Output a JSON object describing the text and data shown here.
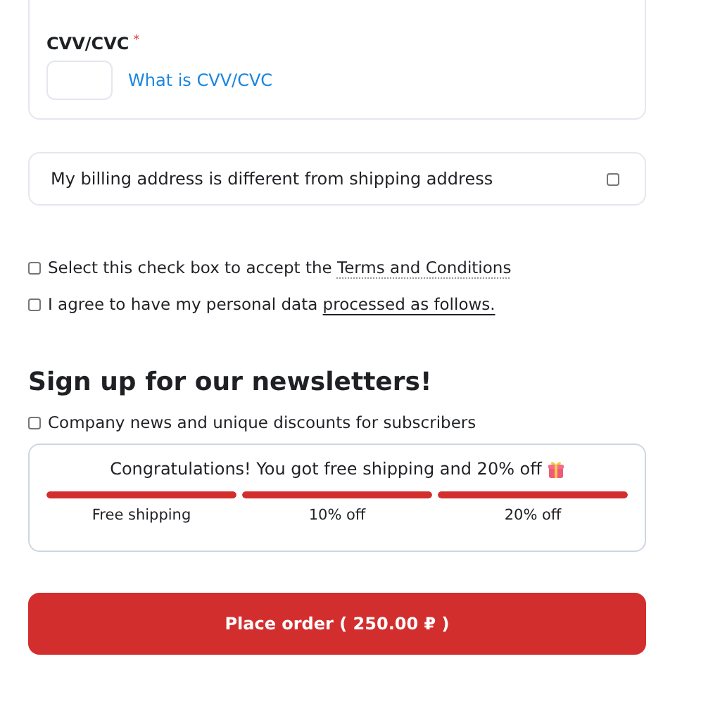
{
  "cvv": {
    "label": "CVV/CVC",
    "required_mark": "*",
    "help_link": "What is CVV/CVC"
  },
  "billing": {
    "label": "My billing address is different from shipping address",
    "checked": false
  },
  "agreements": [
    {
      "text": "Select this check box to accept the",
      "link": "Terms and Conditions",
      "kind": "dotted",
      "checked": false
    },
    {
      "text": "I agree to have my personal data",
      "link": "processed as follows.",
      "kind": "solid",
      "checked": false
    }
  ],
  "newsletter": {
    "title": "Sign up for our newsletters!",
    "label": "Company news and unique discounts for subscribers",
    "checked": false
  },
  "rewards": {
    "message": "Congratulations! You got free shipping and 20% off",
    "steps": [
      {
        "label": "Free shipping",
        "level": 1
      },
      {
        "label": "10% off",
        "level": 1
      },
      {
        "label": "20% off",
        "level": 1
      }
    ]
  },
  "place_order": "Place order ( 250.00 ₽ )"
}
